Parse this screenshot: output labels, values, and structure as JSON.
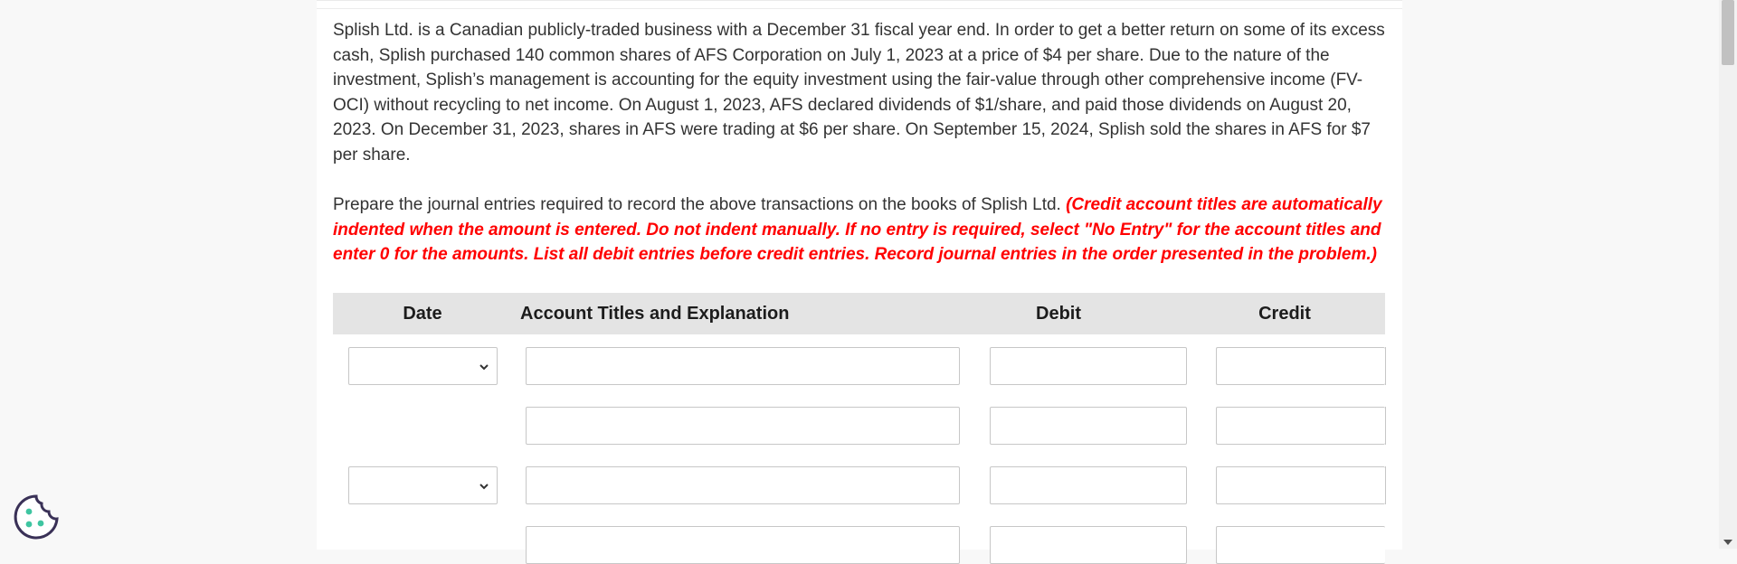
{
  "problem": {
    "text": "Splish Ltd. is a Canadian publicly-traded business with a December 31 fiscal year end. In order to get a better return on some of its excess cash, Splish purchased 140 common shares of AFS Corporation on July 1, 2023 at a price of $4 per share. Due to the nature of the investment, Splish’s management is accounting for the equity investment using the fair-value through other comprehensive income (FV-OCI) without recycling to net income. On August 1, 2023, AFS declared dividends of $1/share, and paid those dividends on August 20, 2023. On December 31, 2023, shares in AFS were trading at $6 per share. On September 15, 2024, Splish sold the shares in AFS for $7 per share."
  },
  "instructions": {
    "text": "Prepare the journal entries required to record the above transactions on the books of Splish Ltd. ",
    "hint": "(Credit account titles are automatically indented when the amount is entered. Do not indent manually. If no entry is required, select \"No Entry\" for the account titles and enter 0 for the amounts. List all debit entries before credit entries. Record journal entries in the order presented in the problem.)"
  },
  "table": {
    "headers": {
      "date": "Date",
      "account": "Account Titles and Explanation",
      "debit": "Debit",
      "credit": "Credit"
    },
    "rows": [
      {
        "date": "",
        "account": "",
        "debit": "",
        "credit": ""
      },
      {
        "account": "",
        "debit": "",
        "credit": ""
      },
      {
        "date": "",
        "account": "",
        "debit": "",
        "credit": ""
      },
      {
        "account": "",
        "debit": "",
        "credit": ""
      }
    ]
  },
  "icons": {
    "date_dropdown": "chevron-down-icon",
    "cookie_settings": "cookie-icon",
    "scroll_down": "scroll-down-arrow"
  }
}
